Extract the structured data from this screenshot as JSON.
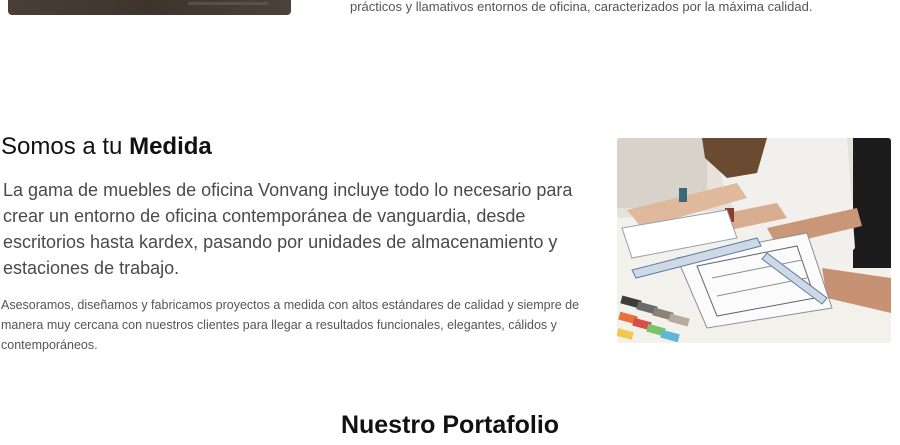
{
  "intro": {
    "text": "prácticos y llamativos entornos de oficina, caracterizados por la máxima calidad."
  },
  "medida": {
    "title_regular": "Somos a tu",
    "title_bold": "Medida",
    "lead": "La gama de muebles de oficina Vonvang incluye todo lo necesario para crear un entorno de oficina contemporánea de vanguardia, desde escritorios hasta kardex, pasando por unidades de almacenamiento y estaciones de trabajo.",
    "body": "Asesoramos, diseñamos y fabricamos proyectos a medida con altos estándares de calidad y siempre de manera muy cercana con nuestros clientes para llegar a resultados funcionales, elegantes, cálidos y contemporáneos."
  },
  "portfolio": {
    "title_regular": "Nuestro",
    "title_bold": "Portafolio"
  },
  "colors": {
    "heading": "#111111",
    "lead": "#4a4a4a",
    "body": "#555555"
  }
}
